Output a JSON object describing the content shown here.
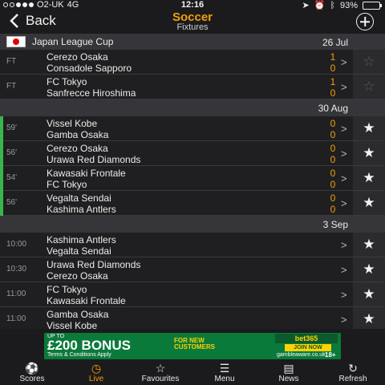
{
  "status": {
    "carrier": "O2-UK",
    "network": "4G",
    "time": "12:16",
    "battery": "93%"
  },
  "header": {
    "back_label": "Back",
    "title": "Soccer",
    "subtitle": "Fixtures"
  },
  "competition": {
    "name": "Japan League Cup",
    "date": "26 Jul"
  },
  "groups": [
    {
      "matches": [
        {
          "status": "FT",
          "home": "Cerezo Osaka",
          "away": "Consadole Sapporo",
          "home_score": "1",
          "away_score": "0",
          "fav": false
        },
        {
          "status": "FT",
          "home": "FC Tokyo",
          "away": "Sanfrecce Hiroshima",
          "home_score": "1",
          "away_score": "0",
          "fav": false
        }
      ]
    },
    {
      "date": "30 Aug",
      "matches": [
        {
          "status": "59'",
          "home": "Vissel Kobe",
          "away": "Gamba Osaka",
          "home_score": "0",
          "away_score": "0",
          "fav": true
        },
        {
          "status": "56'",
          "home": "Cerezo Osaka",
          "away": "Urawa Red Diamonds",
          "home_score": "0",
          "away_score": "0",
          "fav": true
        },
        {
          "status": "54'",
          "home": "Kawasaki Frontale",
          "away": "FC Tokyo",
          "home_score": "0",
          "away_score": "0",
          "fav": true
        },
        {
          "status": "56'",
          "home": "Vegalta Sendai",
          "away": "Kashima Antlers",
          "home_score": "0",
          "away_score": "0",
          "fav": true
        }
      ]
    },
    {
      "date": "3 Sep",
      "matches": [
        {
          "status": "10:00",
          "home": "Kashima Antlers",
          "away": "Vegalta Sendai",
          "home_score": "",
          "away_score": "",
          "fav": true
        },
        {
          "status": "10:30",
          "home": "Urawa Red Diamonds",
          "away": "Cerezo Osaka",
          "home_score": "",
          "away_score": "",
          "fav": true
        },
        {
          "status": "11:00",
          "home": "FC Tokyo",
          "away": "Kawasaki Frontale",
          "home_score": "",
          "away_score": "",
          "fav": true
        },
        {
          "status": "11:00",
          "home": "Gamba Osaka",
          "away": "Vissel Kobe",
          "home_score": "",
          "away_score": "",
          "fav": true
        }
      ]
    }
  ],
  "ad": {
    "up_to": "UP TO",
    "bonus": "£200 BONUS",
    "for_new": "FOR NEW",
    "customers": "CUSTOMERS",
    "terms": "Terms & Conditions Apply",
    "brand": "bet365",
    "join": "JOIN NOW",
    "gamble": "gambleaware.co.uk",
    "age": "18+"
  },
  "tabs": [
    {
      "label": "Scores",
      "icon": "soccer-ball-icon",
      "active": false
    },
    {
      "label": "Live",
      "icon": "live-clock-icon",
      "active": true
    },
    {
      "label": "Favourites",
      "icon": "star-icon",
      "active": false
    },
    {
      "label": "Menu",
      "icon": "menu-icon",
      "active": false
    },
    {
      "label": "News",
      "icon": "newspaper-icon",
      "active": false
    },
    {
      "label": "Refresh",
      "icon": "refresh-icon",
      "active": false
    }
  ],
  "colors": {
    "accent": "#f2a007",
    "live": "#39b54a",
    "ad_green": "#0a7a3a"
  }
}
